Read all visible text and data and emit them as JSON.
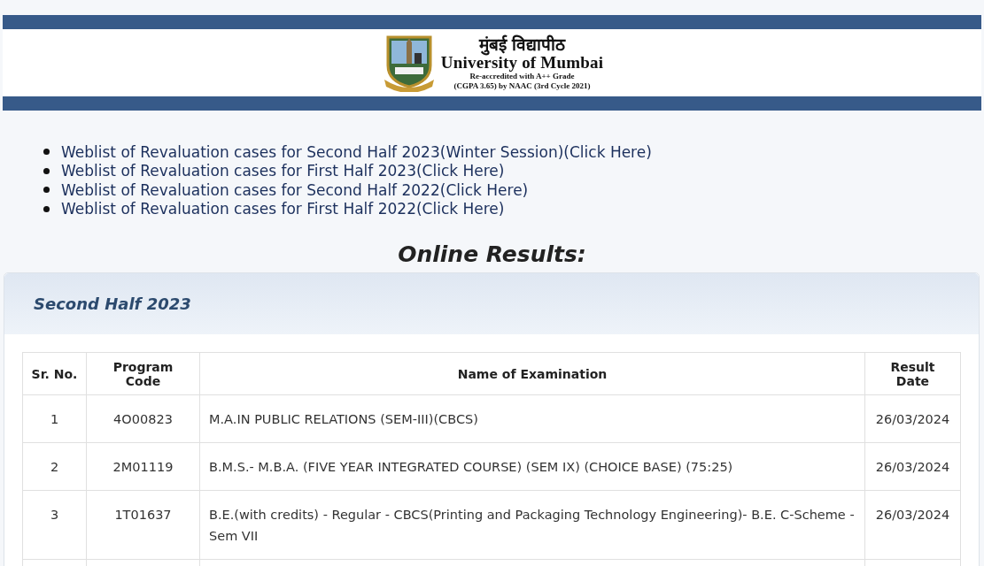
{
  "header": {
    "title_marathi": "मुंबई विद्यापीठ",
    "title_english": "University of Mumbai",
    "accreditation": "Re-accredited with A++ Grade",
    "grade_line": "(CGPA 3.65) by NAAC (3rd Cycle 2021)"
  },
  "links": [
    "Weblist of Revaluation cases for Second Half 2023(Winter Session)(Click Here)",
    "Weblist of Revaluation cases for First Half 2023(Click Here)",
    "Weblist of Revaluation cases for Second Half 2022(Click Here)",
    "Weblist of Revaluation cases for First Half 2022(Click Here)"
  ],
  "heading": "Online Results:",
  "section": {
    "title": "Second Half 2023",
    "table": {
      "columns": [
        "Sr. No.",
        "Program Code",
        "Name of Examination",
        "Result Date"
      ],
      "rows": [
        {
          "sr_no": "1",
          "program_code": "4O00823",
          "name": "M.A.IN PUBLIC RELATIONS (SEM-III)(CBCS)",
          "result_date": "26/03/2024"
        },
        {
          "sr_no": "2",
          "program_code": "2M01119",
          "name": "B.M.S.- M.B.A. (FIVE YEAR INTEGRATED COURSE) (SEM IX) (CHOICE BASE) (75:25)",
          "result_date": "26/03/2024"
        },
        {
          "sr_no": "3",
          "program_code": "1T01637",
          "name": "B.E.(with credits) - Regular - CBCS(Printing and Packaging Technology Engineering)- B.E. C-Scheme - Sem VII",
          "result_date": "26/03/2024"
        }
      ]
    }
  }
}
